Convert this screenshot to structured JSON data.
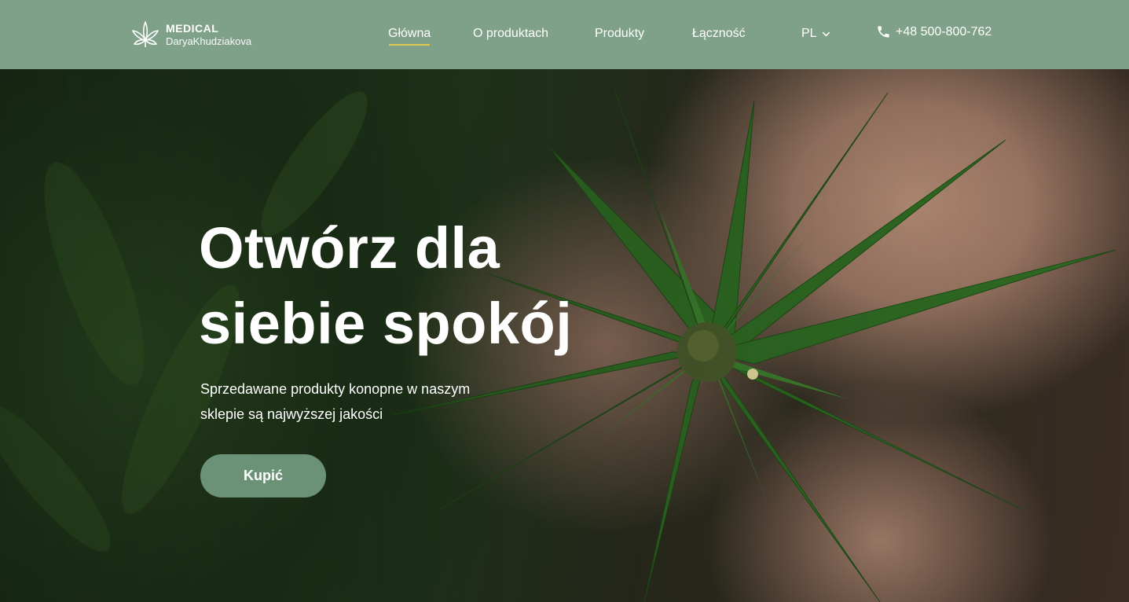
{
  "header": {
    "logo": {
      "title": "MEDICAL",
      "subtitle": "DaryaKhudziakova",
      "icon": "cannabis-leaf-icon"
    },
    "nav": [
      {
        "label": "Główna",
        "active": true
      },
      {
        "label": "O produktach",
        "active": false
      },
      {
        "label": "Produkty",
        "active": false
      },
      {
        "label": "Łączność",
        "active": false
      }
    ],
    "language": {
      "selected": "PL",
      "icon": "chevron-down-icon"
    },
    "phone": {
      "number": "+48 500-800-762",
      "icon": "phone-icon"
    }
  },
  "hero": {
    "title": "Otwórz dla siebie spokój",
    "subtitle": "Sprzedawane produkty konopne w naszym sklepie są najwyższej jakości",
    "button_label": "Kupić",
    "background": "cannabis-plant-in-hands-photo"
  },
  "colors": {
    "header_bg": "#7fa089",
    "button_bg": "#6b9276",
    "active_underline": "#e2c84a",
    "text": "#ffffff"
  }
}
